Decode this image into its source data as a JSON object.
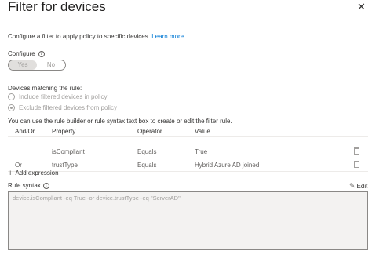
{
  "panel": {
    "title": "Filter for devices",
    "description": "Configure a filter to apply policy to specific devices.",
    "learn_more": "Learn more"
  },
  "configure": {
    "label": "Configure",
    "options": [
      "Yes",
      "No"
    ],
    "selected": "Yes"
  },
  "matching": {
    "label": "Devices matching the rule:",
    "options": [
      {
        "label": "Include filtered devices in policy",
        "selected": false
      },
      {
        "label": "Exclude filtered devices from policy",
        "selected": true
      }
    ]
  },
  "builder": {
    "instructions": "You can use the rule builder or rule syntax text box to create or edit the filter rule.",
    "headers": {
      "andor": "And/Or",
      "property": "Property",
      "operator": "Operator",
      "value": "Value"
    },
    "rows": [
      {
        "andor": "",
        "property": "isCompliant",
        "operator": "Equals",
        "value": "True"
      },
      {
        "andor": "Or",
        "property": "trustType",
        "operator": "Equals",
        "value": "Hybrid Azure AD joined"
      }
    ],
    "add_expression": "Add expression"
  },
  "rule_syntax": {
    "label": "Rule syntax",
    "edit_label": "Edit",
    "value": "device.isCompliant -eq True -or device.trustType -eq \"ServerAD\""
  }
}
